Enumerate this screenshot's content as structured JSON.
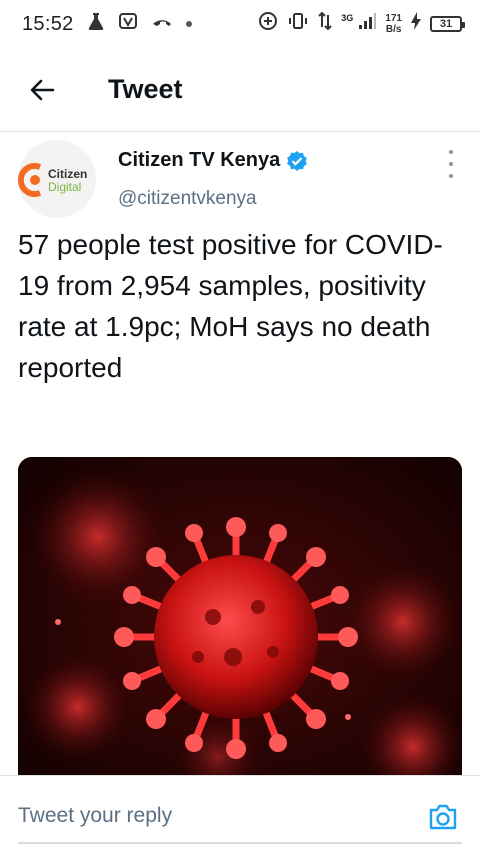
{
  "status_bar": {
    "time": "15:52",
    "net_speed_value": "171",
    "net_speed_unit": "B/s",
    "network_type": "3G",
    "battery_level": "31",
    "left_icons": [
      "flask-icon",
      "v-app-icon",
      "missed-call-icon",
      "dot-icon"
    ],
    "right_icons": [
      "data-saver-icon",
      "vibrate-icon",
      "data-transfer-icon",
      "signal-icon",
      "charging-icon",
      "battery-icon"
    ]
  },
  "app_bar": {
    "title": "Tweet",
    "back_icon": "arrow-left-icon"
  },
  "tweet": {
    "author": {
      "name": "Citizen TV Kenya",
      "handle": "@citizentvkenya",
      "verified": true,
      "avatar_text_top": "Citizen",
      "avatar_text_bottom": "Digital"
    },
    "text": "57 people test positive for COVID-19 from 2,954 samples, positivity rate at 1.9pc; MoH says no death reported",
    "media": {
      "kind": "image",
      "subject": "virus-illustration"
    }
  },
  "reply": {
    "placeholder": "Tweet your reply",
    "camera_icon": "camera-icon"
  },
  "colors": {
    "accent": "#1da1f2",
    "text_primary": "#0f1419",
    "text_secondary": "#5b7083",
    "verified": "#1da1f2",
    "logo_orange": "#f26b21",
    "logo_green": "#7cb342",
    "divider": "#dfe3e6"
  }
}
